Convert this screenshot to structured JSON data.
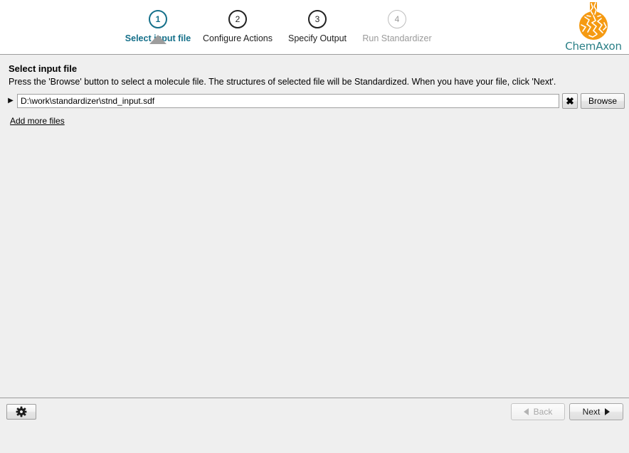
{
  "wizard": {
    "steps": [
      {
        "number": "1",
        "label": "Select input file",
        "state": "current"
      },
      {
        "number": "2",
        "label": "Configure Actions",
        "state": "active"
      },
      {
        "number": "3",
        "label": "Specify Output",
        "state": "active"
      },
      {
        "number": "4",
        "label": "Run Standardizer",
        "state": "disabled"
      }
    ],
    "accent_color": "#15708a"
  },
  "logo": {
    "text": "ChemAxon",
    "mark_icon": "flask-icon",
    "mark_color": "#f59a12",
    "text_color": "#2a7f86"
  },
  "panel": {
    "title": "Select input file",
    "description": "Press the 'Browse' button to select a molecule file. The structures of selected file will be Standardized. When you have your file, click 'Next'.",
    "expand_icon": "triangle-right-icon",
    "file_path_value": "D:\\work\\standardizer\\stnd_input.sdf",
    "file_path_placeholder": "",
    "clear_label": "✖",
    "browse_label": "Browse",
    "add_more_files_label": "Add more files"
  },
  "bottom_bar": {
    "settings_icon": "gear-icon",
    "back_label": "Back",
    "next_label": "Next",
    "back_enabled": false,
    "next_enabled": true
  }
}
